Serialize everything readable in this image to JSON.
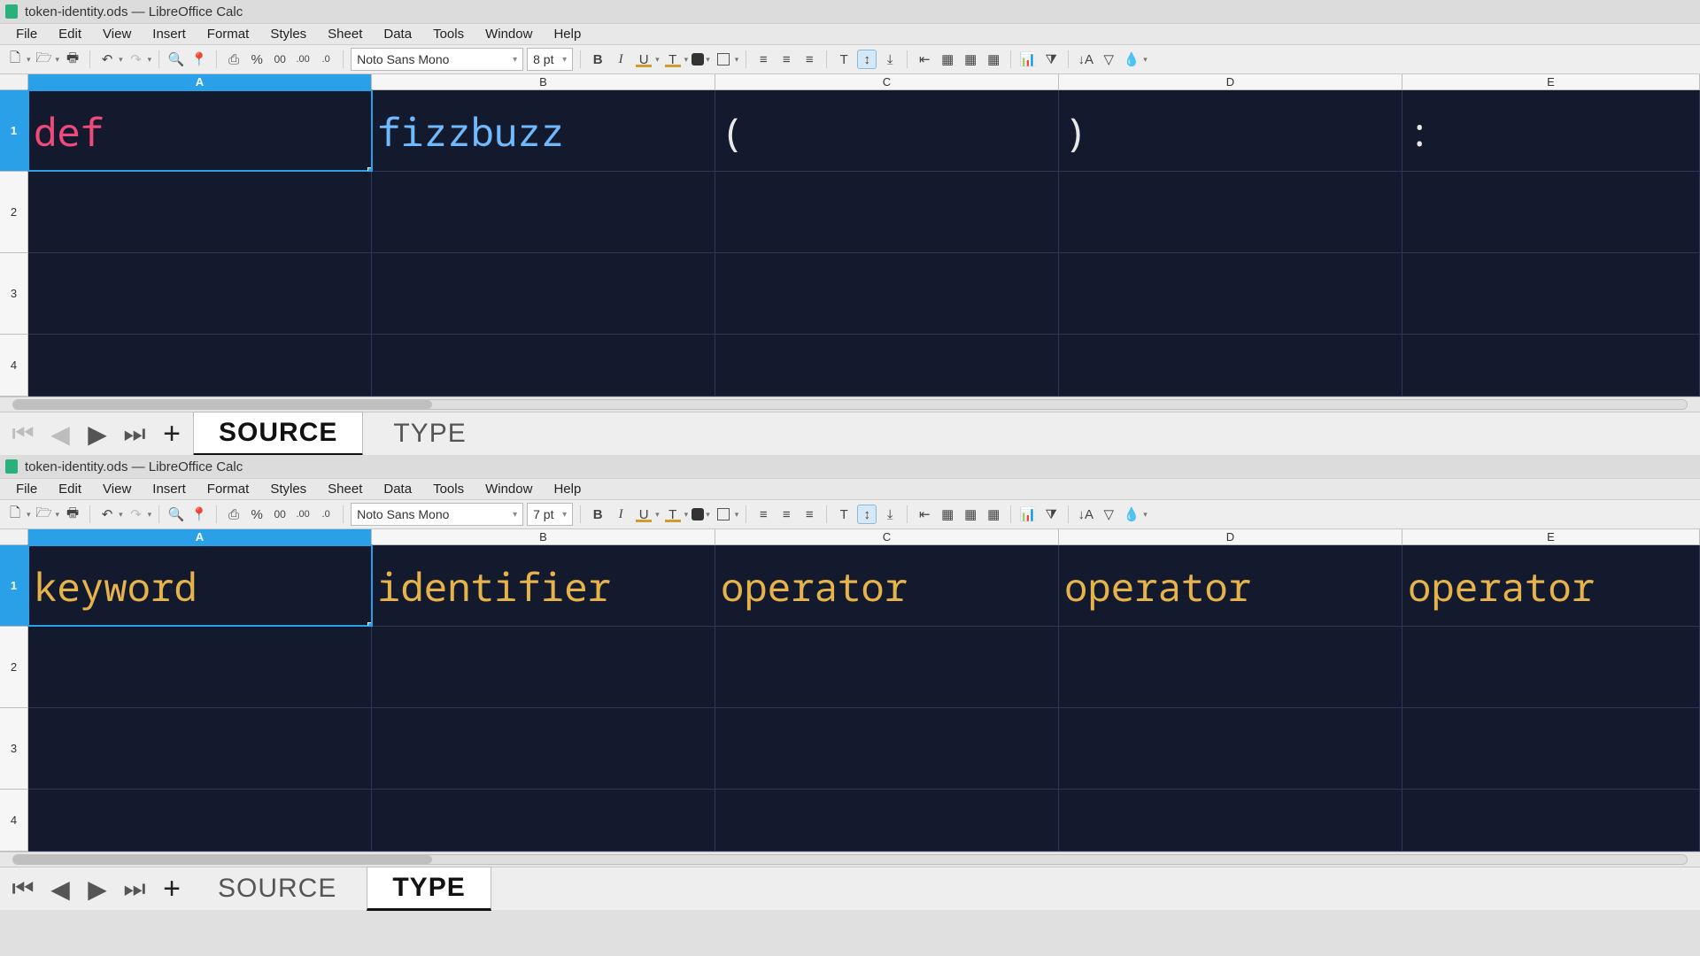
{
  "app": {
    "title": "token-identity.ods — LibreOffice Calc"
  },
  "menu": {
    "file": "File",
    "edit": "Edit",
    "view": "View",
    "insert": "Insert",
    "format": "Format",
    "styles": "Styles",
    "sheet": "Sheet",
    "data": "Data",
    "tools": "Tools",
    "window": "Window",
    "help": "Help"
  },
  "toolbar": {
    "font_name": "Noto Sans Mono",
    "font_size_top": "8 pt",
    "font_size_bottom": "7 pt"
  },
  "columns": {
    "A": "A",
    "B": "B",
    "C": "C",
    "D": "D",
    "E": "E"
  },
  "rows": {
    "r1": "1",
    "r2": "2",
    "r3": "3",
    "r4": "4"
  },
  "sheet_source": {
    "A1": "def",
    "B1": "fizzbuzz",
    "C1": "(",
    "D1": ")",
    "E1": ":"
  },
  "sheet_type": {
    "A1": "keyword",
    "B1": "identifier",
    "C1": "operator",
    "D1": "operator",
    "E1": "operator"
  },
  "tabs": {
    "source": "SOURCE",
    "type": "TYPE"
  },
  "icons": {
    "new": "new-icon",
    "open": "open-icon",
    "print": "print-icon",
    "undo": "undo-icon",
    "redo": "redo-icon",
    "find": "find-icon",
    "paste": "paste-icon",
    "image": "image-icon",
    "percent": "percent-icon",
    "thousand": "thousand-icon",
    "dec_add": "add-decimal-icon",
    "dec_remove": "remove-decimal-icon",
    "bold": "bold-icon",
    "italic": "italic-icon",
    "underline": "underline-icon",
    "font_color": "font-color-icon",
    "highlight": "highlight-color-icon",
    "borders": "borders-icon",
    "align_left": "align-left-icon",
    "align_center": "align-center-icon",
    "align_right": "align-right-icon",
    "valign_top": "valign-top-icon",
    "valign_mid": "valign-middle-icon",
    "valign_bot": "valign-bottom-icon",
    "indent_dec": "decrease-indent-icon",
    "merge": "merge-cells-icon",
    "merge2": "merge-cells-icon-2",
    "merge3": "merge-cells-icon-3",
    "chart": "chart-icon",
    "autofilter": "autofilter-icon",
    "sort_asc": "sort-asc-icon",
    "cond": "conditional-icon",
    "fill": "fill-color-icon"
  }
}
